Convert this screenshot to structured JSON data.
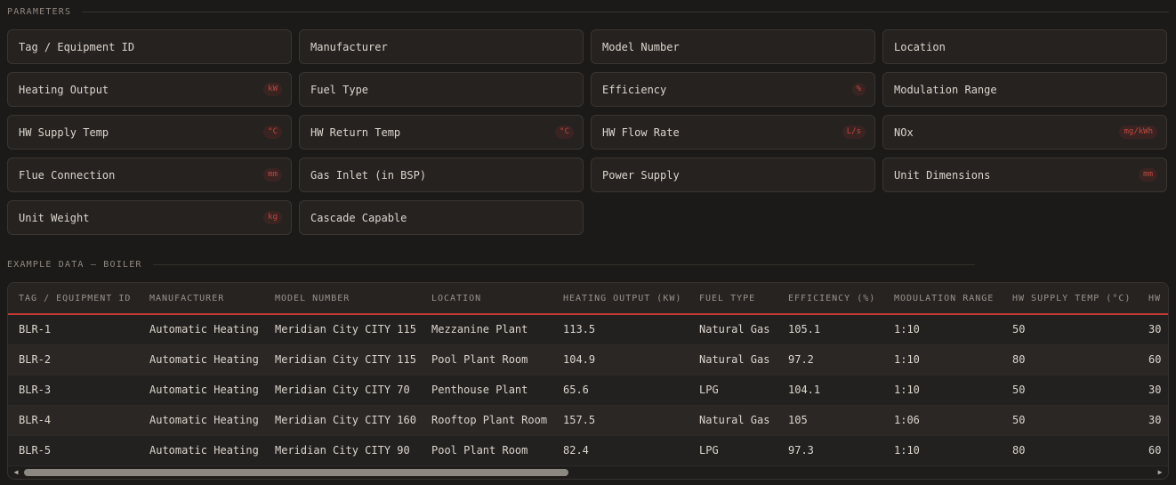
{
  "parameters_title": "PARAMETERS",
  "example_title": "EXAMPLE DATA — BOILER",
  "parameters": [
    {
      "label": "Tag / Equipment ID",
      "unit": ""
    },
    {
      "label": "Manufacturer",
      "unit": ""
    },
    {
      "label": "Model Number",
      "unit": ""
    },
    {
      "label": "Location",
      "unit": ""
    },
    {
      "label": "Heating Output",
      "unit": "kW"
    },
    {
      "label": "Fuel Type",
      "unit": ""
    },
    {
      "label": "Efficiency",
      "unit": "%"
    },
    {
      "label": "Modulation Range",
      "unit": ""
    },
    {
      "label": "HW Supply Temp",
      "unit": "°C"
    },
    {
      "label": "HW Return Temp",
      "unit": "°C"
    },
    {
      "label": "HW Flow Rate",
      "unit": "L/s"
    },
    {
      "label": "NOx",
      "unit": "mg/kWh"
    },
    {
      "label": "Flue Connection",
      "unit": "mm"
    },
    {
      "label": "Gas Inlet (in BSP)",
      "unit": ""
    },
    {
      "label": "Power Supply",
      "unit": ""
    },
    {
      "label": "Unit Dimensions",
      "unit": "mm"
    },
    {
      "label": "Unit Weight",
      "unit": "kg"
    },
    {
      "label": "Cascade Capable",
      "unit": ""
    }
  ],
  "table": {
    "columns": [
      "TAG / EQUIPMENT ID",
      "MANUFACTURER",
      "MODEL NUMBER",
      "LOCATION",
      "HEATING OUTPUT (KW)",
      "FUEL TYPE",
      "EFFICIENCY (%)",
      "MODULATION RANGE",
      "HW SUPPLY TEMP (°C)",
      "HW"
    ],
    "rows": [
      [
        "BLR-1",
        "Automatic Heating",
        "Meridian City CITY 115",
        "Mezzanine Plant",
        "113.5",
        "Natural Gas",
        "105.1",
        "1:10",
        "50",
        "30"
      ],
      [
        "BLR-2",
        "Automatic Heating",
        "Meridian City CITY 115",
        "Pool Plant Room",
        "104.9",
        "Natural Gas",
        "97.2",
        "1:10",
        "80",
        "60"
      ],
      [
        "BLR-3",
        "Automatic Heating",
        "Meridian City CITY 70",
        "Penthouse Plant",
        "65.6",
        "LPG",
        "104.1",
        "1:10",
        "50",
        "30"
      ],
      [
        "BLR-4",
        "Automatic Heating",
        "Meridian City CITY 160",
        "Rooftop Plant Room",
        "157.5",
        "Natural Gas",
        "105",
        "1:06",
        "50",
        "30"
      ],
      [
        "BLR-5",
        "Automatic Heating",
        "Meridian City CITY 90",
        "Pool Plant Room",
        "82.4",
        "LPG",
        "97.3",
        "1:10",
        "80",
        "60"
      ]
    ]
  },
  "scrollbar": {
    "left_icon": "scroll-left-icon",
    "right_icon": "scroll-right-icon"
  }
}
